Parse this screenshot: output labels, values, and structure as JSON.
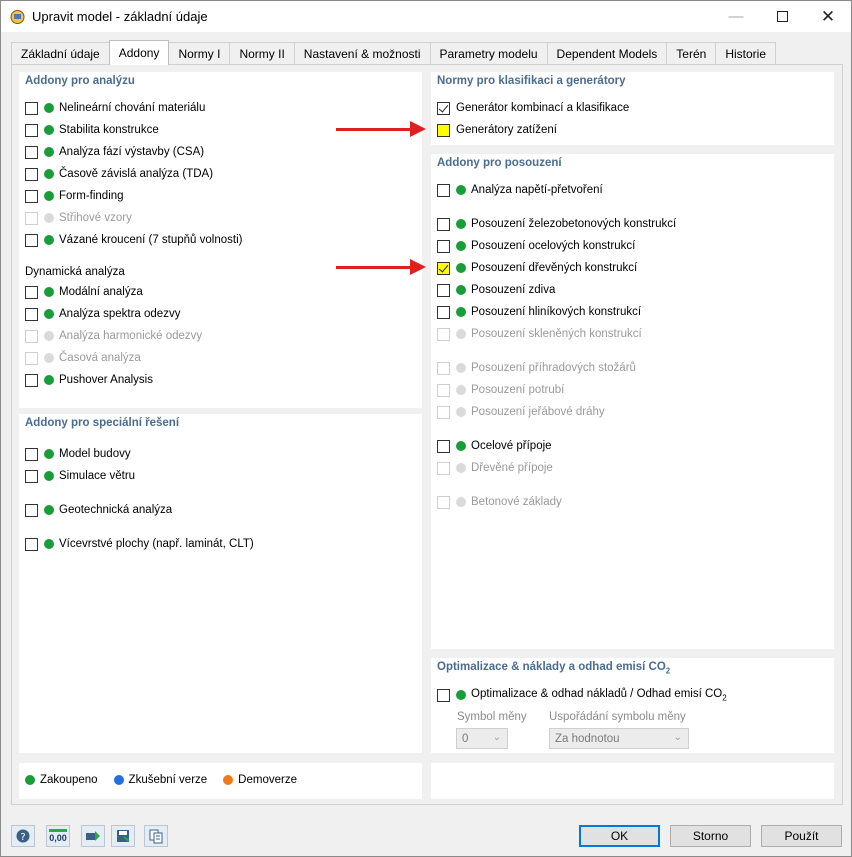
{
  "window": {
    "title": "Upravit model - základní údaje"
  },
  "tabs": [
    {
      "label": "Základní údaje"
    },
    {
      "label": "Addony",
      "active": true
    },
    {
      "label": "Normy I"
    },
    {
      "label": "Normy II"
    },
    {
      "label": "Nastavení & možnosti"
    },
    {
      "label": "Parametry modelu"
    },
    {
      "label": "Dependent Models"
    },
    {
      "label": "Terén"
    },
    {
      "label": "Historie"
    }
  ],
  "analysis": {
    "title": "Addony pro analýzu",
    "items": [
      {
        "label": "Nelineární chování materiálu",
        "enabled": true
      },
      {
        "label": "Stabilita konstrukce",
        "enabled": true
      },
      {
        "label": "Analýza fází výstavby (CSA)",
        "enabled": true
      },
      {
        "label": "Časově závislá analýza (TDA)",
        "enabled": true
      },
      {
        "label": "Form-finding",
        "enabled": true
      },
      {
        "label": "Střihové vzory",
        "enabled": false
      },
      {
        "label": "Vázané kroucení (7 stupňů volnosti)",
        "enabled": true
      }
    ],
    "dynamic_label": "Dynamická analýza",
    "dynamic_items": [
      {
        "label": "Modální analýza",
        "enabled": true
      },
      {
        "label": "Analýza spektra odezvy",
        "enabled": true
      },
      {
        "label": "Analýza harmonické odezvy",
        "enabled": false
      },
      {
        "label": "Časová analýza",
        "enabled": false
      },
      {
        "label": "Pushover Analysis",
        "enabled": true
      }
    ]
  },
  "special": {
    "title": "Addony pro speciální řešení",
    "items": [
      {
        "label": "Model budovy"
      },
      {
        "label": "Simulace větru"
      },
      {
        "label": "Geotechnická analýza"
      },
      {
        "label": "Vícevrstvé plochy (např. laminát, CLT)"
      }
    ]
  },
  "norms": {
    "title": "Normy pro klasifikaci a generátory",
    "items": [
      {
        "label": "Generátor kombinací a klasifikace",
        "checked": true
      },
      {
        "label": "Generátory zatížení",
        "highlight": true
      }
    ]
  },
  "design": {
    "title": "Addony pro posouzení",
    "items": [
      {
        "label": "Analýza napětí-přetvoření",
        "enabled": true
      },
      {
        "label": "Posouzení železobetonových konstrukcí",
        "enabled": true
      },
      {
        "label": "Posouzení ocelových konstrukcí",
        "enabled": true
      },
      {
        "label": "Posouzení dřevěných konstrukcí",
        "enabled": true,
        "checked": true,
        "highlight": true
      },
      {
        "label": "Posouzení zdiva",
        "enabled": true
      },
      {
        "label": "Posouzení hliníkových konstrukcí",
        "enabled": true
      },
      {
        "label": "Posouzení skleněných konstrukcí",
        "enabled": false
      },
      {
        "label": "Posouzení příhradových stožárů",
        "enabled": false
      },
      {
        "label": "Posouzení potrubí",
        "enabled": false
      },
      {
        "label": "Posouzení jeřábové dráhy",
        "enabled": false
      },
      {
        "label": "Ocelové přípoje",
        "enabled": true
      },
      {
        "label": "Dřevěné přípoje",
        "enabled": false
      },
      {
        "label": "Betonové základy",
        "enabled": false
      }
    ]
  },
  "optimization": {
    "title": "Optimalizace & náklady a odhad emisí CO",
    "title_sub": "2",
    "item_label": "Optimalizace & odhad nákladů / Odhad emisí CO",
    "item_sub": "2",
    "symbol_label": "Symbol měny",
    "symbol_value": "0",
    "order_label": "Uspořádání symbolu měny",
    "order_value": "Za hodnotou"
  },
  "legend": [
    {
      "label": "Zakoupeno",
      "color": "#1a9c3a"
    },
    {
      "label": "Zkušební verze",
      "color": "#1f6fe0"
    },
    {
      "label": "Demoverze",
      "color": "#f07a1a"
    }
  ],
  "buttons": {
    "ok": "OK",
    "cancel": "Storno",
    "apply": "Použít"
  },
  "toolbar": {
    "units_label": "0,00"
  }
}
